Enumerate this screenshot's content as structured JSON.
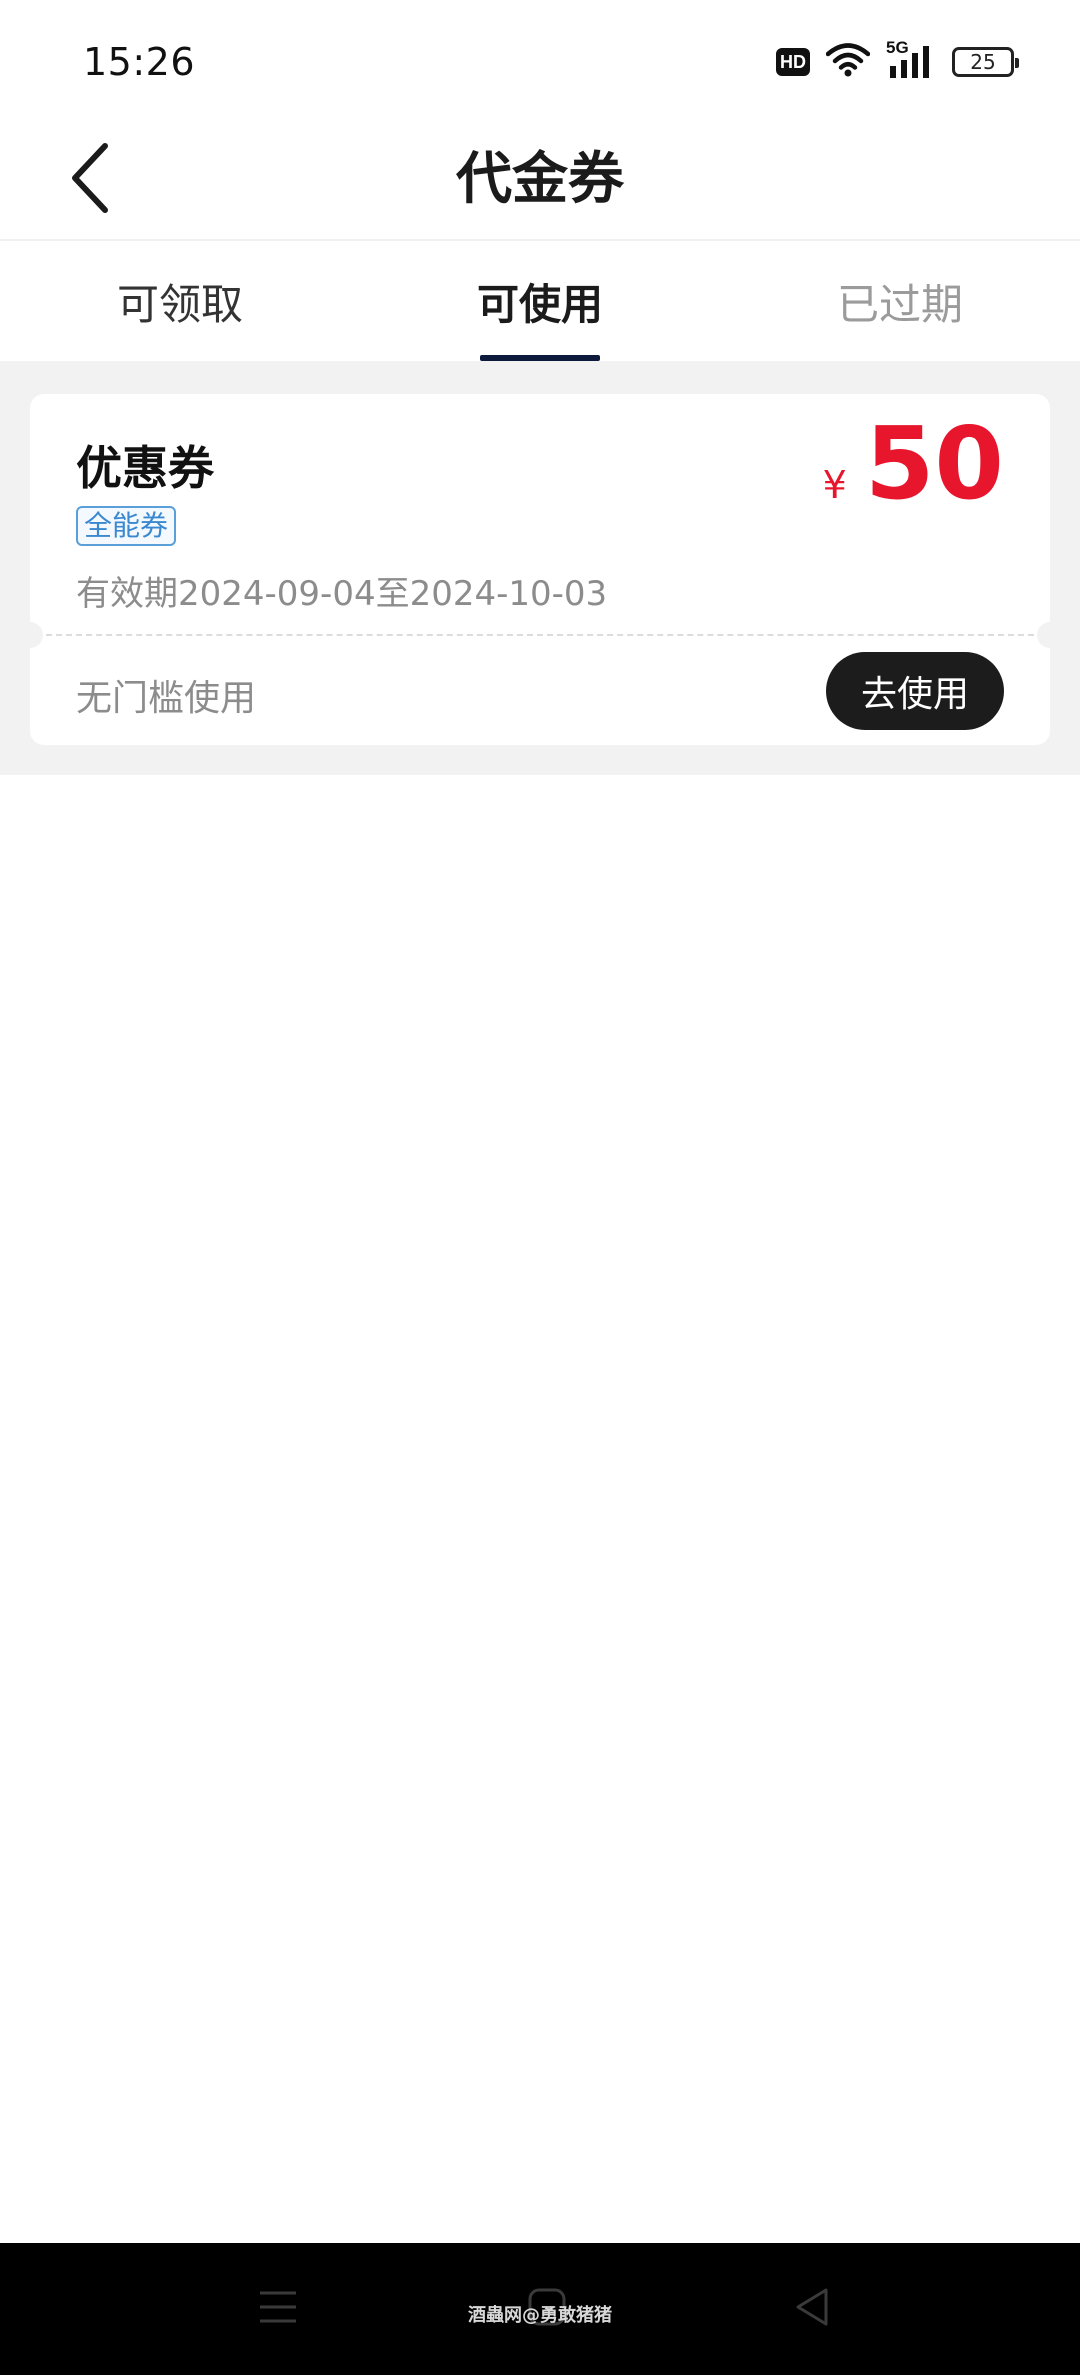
{
  "status_bar": {
    "time": "15:26",
    "hd_label": "HD",
    "network_label": "5G",
    "battery_level": "25"
  },
  "header": {
    "title": "代金券",
    "back_icon": "chevron-left-icon"
  },
  "tabs": [
    {
      "label": "可领取",
      "state": "normal"
    },
    {
      "label": "可使用",
      "state": "active"
    },
    {
      "label": "已过期",
      "state": "disabled"
    }
  ],
  "coupon": {
    "name": "优惠券",
    "tag": "全能券",
    "validity": "有效期2024-09-04至2024-10-03",
    "currency": "¥",
    "amount": "50",
    "condition": "无门槛使用",
    "action_label": "去使用"
  },
  "watermark": "酒蟲网@勇敢猪猪",
  "colors": {
    "accent_red": "#e8162c",
    "tab_indicator": "#0e1a3c",
    "tag_blue": "#3a88cf",
    "button_dark": "#1c1c1c"
  },
  "nav_bar": {
    "icons": [
      "menu-icon",
      "home-icon",
      "back-triangle-icon"
    ]
  }
}
